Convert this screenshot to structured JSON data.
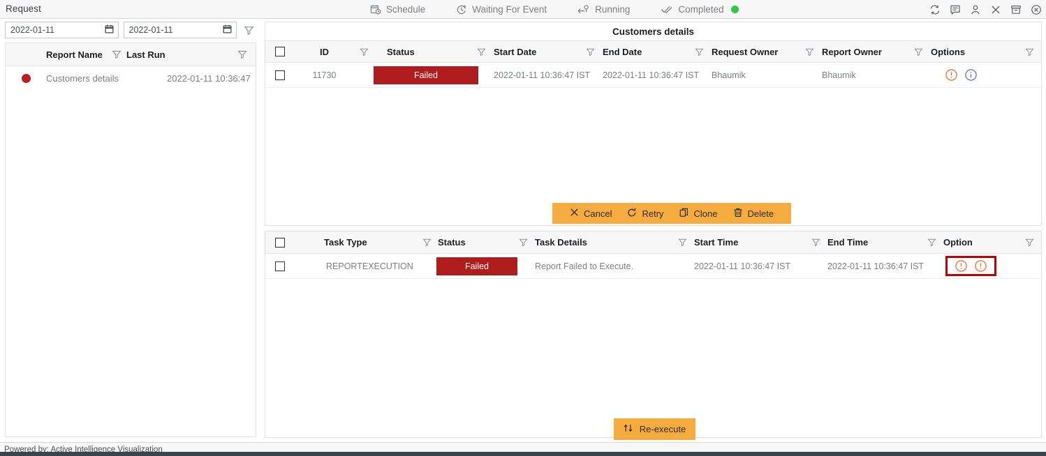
{
  "topbar": {
    "app_title": "Request",
    "nav_items": [
      {
        "label": "Schedule",
        "icon": "calendar-clock-icon"
      },
      {
        "label": "Waiting For Event",
        "icon": "clock-icon"
      },
      {
        "label": "Running",
        "icon": "running-arrow-icon"
      },
      {
        "label": "Completed",
        "icon": "double-check-icon"
      }
    ],
    "completed_dot_color": "#2ecc40",
    "window_icons": [
      "refresh-icon",
      "comment-icon",
      "user-icon",
      "close-x-icon",
      "archive-icon",
      "circle-x-icon"
    ]
  },
  "left_panel": {
    "date_from": "2022-01-11",
    "date_to": "2022-01-11",
    "filter_icon": "funnel-icon",
    "columns": [
      "Report Name",
      "Last Run"
    ],
    "rows": [
      {
        "status_color": "#bb1f1f",
        "report_name": "Customers details",
        "last_run": "2022-01-11 10:36:47"
      }
    ]
  },
  "request_panel": {
    "title": "Customers details",
    "columns": [
      "ID",
      "Status",
      "Start Date",
      "End Date",
      "Request Owner",
      "Report Owner",
      "Options"
    ],
    "rows": [
      {
        "id": "11730",
        "status": "Failed",
        "start_date": "2022-01-11 10:36:47 IST",
        "end_date": "2022-01-11 10:36:47 IST",
        "request_owner": "Bhaumik",
        "report_owner": "Bhaumik",
        "option_icons": [
          "alert-circle-icon",
          "info-circle-icon"
        ]
      }
    ],
    "status_color": "#b01c1c",
    "actions": [
      {
        "label": "Cancel",
        "icon": "x-icon"
      },
      {
        "label": "Retry",
        "icon": "refresh-cw-icon"
      },
      {
        "label": "Clone",
        "icon": "copy-icon"
      },
      {
        "label": "Delete",
        "icon": "trash-icon"
      }
    ],
    "action_bar_color": "#f5ab3d"
  },
  "task_panel": {
    "columns": [
      "Task Type",
      "Status",
      "Task Details",
      "Start Time",
      "End Time",
      "Option"
    ],
    "rows": [
      {
        "task_type": "REPORTEXECUTION",
        "status": "Failed",
        "task_details": "Report Failed to Execute.",
        "start_time": "2022-01-11 10:36:47 IST",
        "end_time": "2022-01-11 10:36:47 IST",
        "option_icons": [
          "alert-circle-icon",
          "alert-circle-icon"
        ],
        "option_highlighted": true
      }
    ],
    "highlight_color": "#c00000",
    "reexecute": {
      "label": "Re-execute",
      "icon": "re-execute-icon"
    }
  },
  "footer": {
    "powered_by": "Powered by: Active Intelligence Visualization"
  }
}
